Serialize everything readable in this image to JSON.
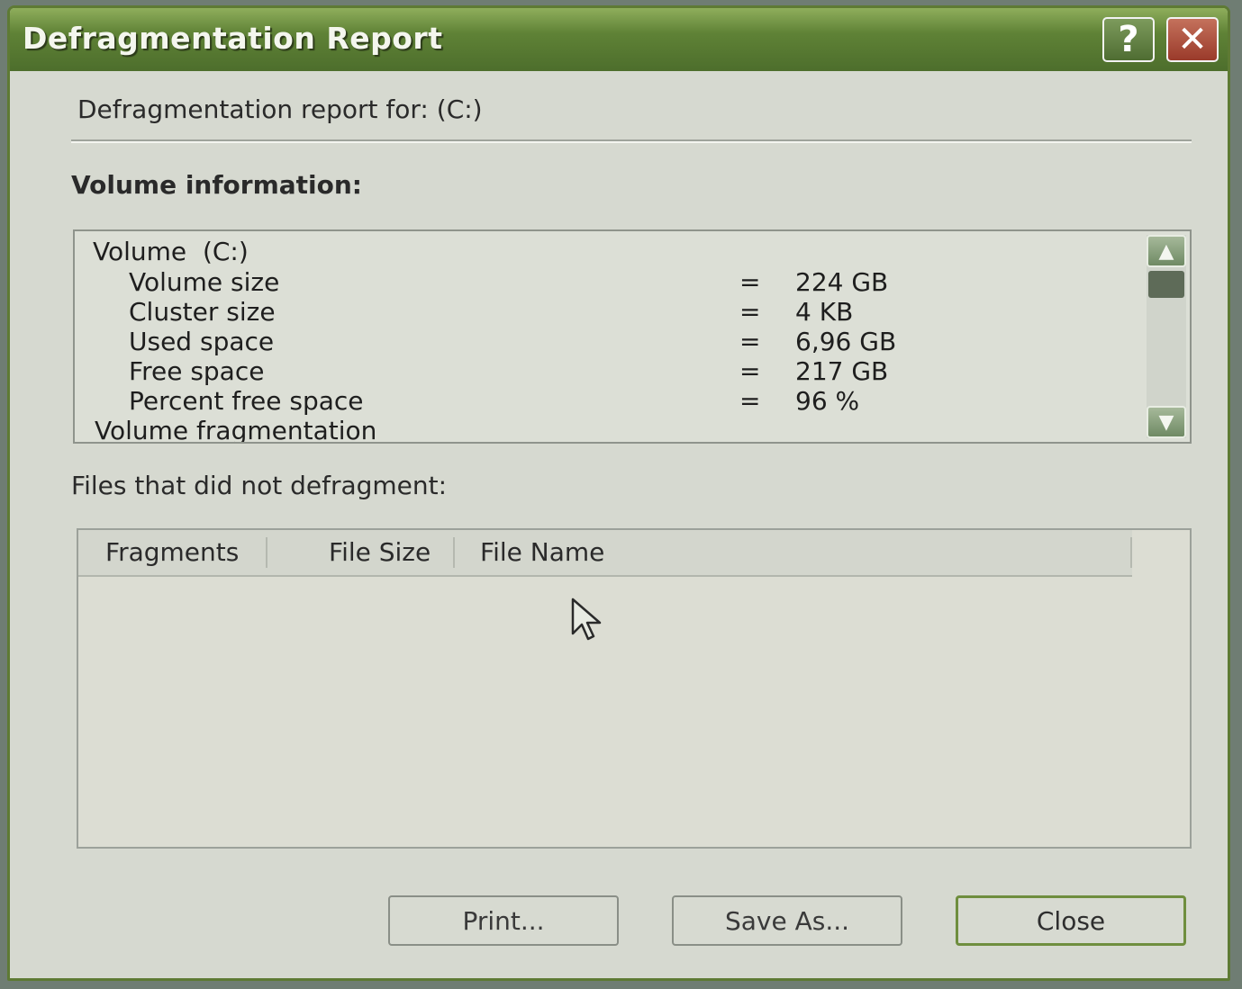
{
  "window": {
    "title": "Defragmentation Report",
    "help_glyph": "?",
    "close_glyph": "✕"
  },
  "report_for": "Defragmentation report for:  (C:)",
  "volume_info_label": "Volume information:",
  "volume": {
    "header": "Volume  (C:)",
    "rows": [
      {
        "label": "Volume size",
        "eq": "=",
        "value": "224 GB"
      },
      {
        "label": "Cluster size",
        "eq": "=",
        "value": "4 KB"
      },
      {
        "label": "Used space",
        "eq": "=",
        "value": "6,96 GB"
      },
      {
        "label": "Free space",
        "eq": "=",
        "value": "217 GB"
      },
      {
        "label": "Percent free space",
        "eq": "=",
        "value": "96 %"
      }
    ],
    "footer": "Volume fragmentation"
  },
  "files_label": "Files that did not defragment:",
  "files_table": {
    "columns": [
      "Fragments",
      "File Size",
      "File Name"
    ],
    "rows": []
  },
  "buttons": {
    "print": "Print...",
    "save_as": "Save As...",
    "close": "Close"
  },
  "colors": {
    "titlebar": "#5f8236",
    "dialog_bg": "#d6d9d0",
    "close_button": "#9a3a2a"
  }
}
